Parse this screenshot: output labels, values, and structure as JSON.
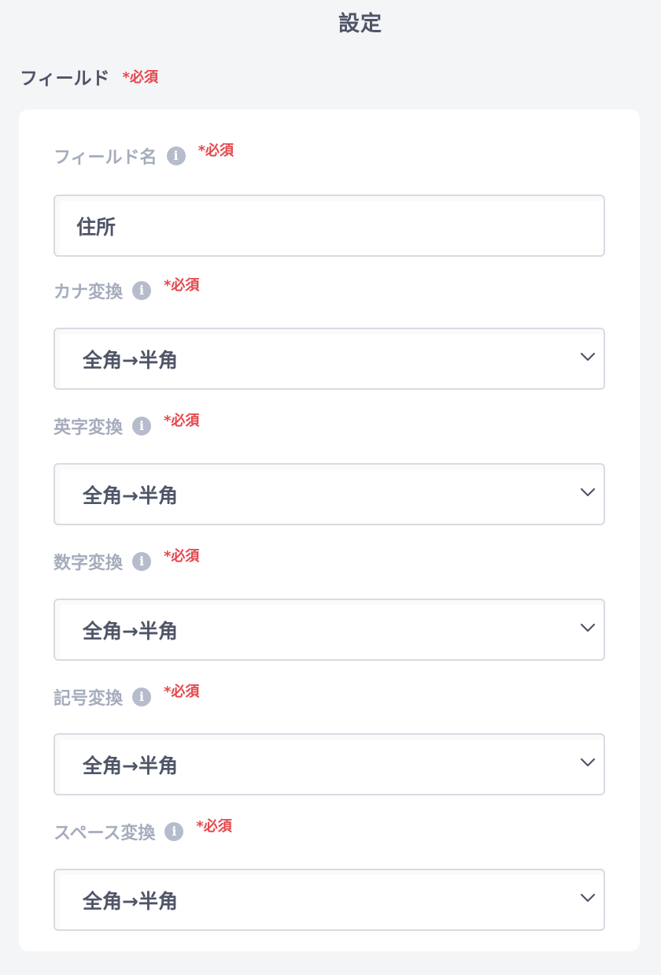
{
  "header": {
    "title": "設定"
  },
  "section": {
    "label": "フィールド",
    "required": "*必須"
  },
  "fields": [
    {
      "label": "フィールド名",
      "required": "*必須",
      "type": "text",
      "value": "住所"
    },
    {
      "label": "カナ変換",
      "required": "*必須",
      "type": "select",
      "value": "全角→半角"
    },
    {
      "label": "英字変換",
      "required": "*必須",
      "type": "select",
      "value": "全角→半角"
    },
    {
      "label": "数字変換",
      "required": "*必須",
      "type": "select",
      "value": "全角→半角"
    },
    {
      "label": "記号変換",
      "required": "*必須",
      "type": "select",
      "value": "全角→半角"
    },
    {
      "label": "スペース変換",
      "required": "*必須",
      "type": "select",
      "value": "全角→半角"
    }
  ],
  "icons": {
    "info": "info-icon",
    "select_arrow": "chevron-down-icon"
  },
  "colors": {
    "background": "#f4f5f7",
    "card": "#ffffff",
    "required": "#e5484d",
    "label": "#a5acbc",
    "text": "#4f5567"
  }
}
